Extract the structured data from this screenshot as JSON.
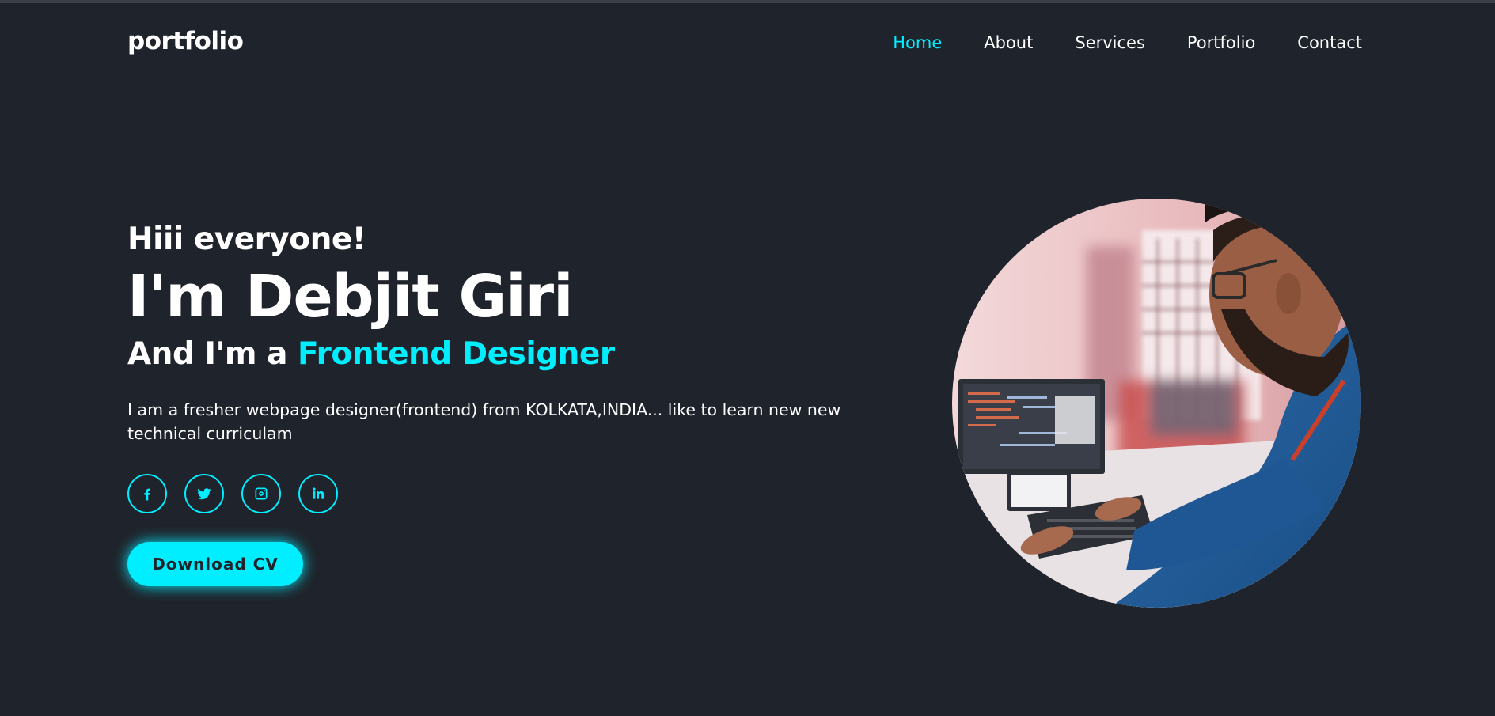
{
  "header": {
    "logo": "portfolio",
    "nav": [
      {
        "label": "Home",
        "active": true
      },
      {
        "label": "About",
        "active": false
      },
      {
        "label": "Services",
        "active": false
      },
      {
        "label": "Portfolio",
        "active": false
      },
      {
        "label": "Contact",
        "active": false
      }
    ]
  },
  "hero": {
    "greeting": "Hiii everyone!",
    "name": "I'm Debjit Giri",
    "role_prefix": "And I'm a ",
    "role_highlight": "Frontend Designer",
    "description": "I am a fresher webpage designer(frontend) from KOLKATA,INDIA... like to learn new new technical curriculam",
    "socials": [
      {
        "icon": "facebook-icon"
      },
      {
        "icon": "twitter-icon"
      },
      {
        "icon": "instagram-icon"
      },
      {
        "icon": "linkedin-icon"
      }
    ],
    "cv_button": "Download CV"
  },
  "colors": {
    "background": "#1f232b",
    "accent": "#00eeff",
    "text": "#ffffff"
  }
}
